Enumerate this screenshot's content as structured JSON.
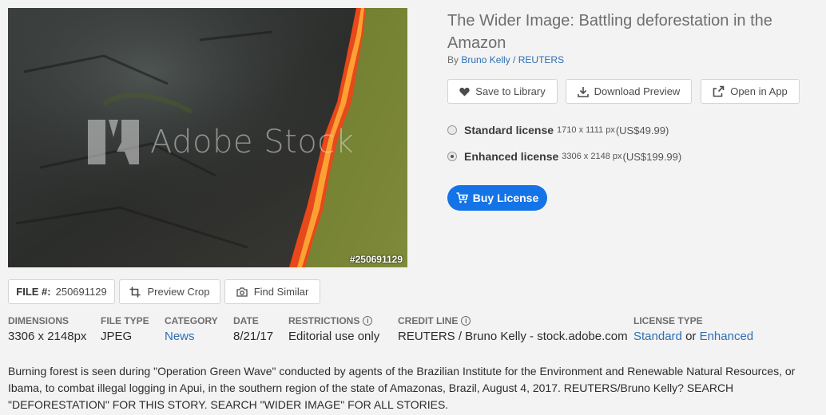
{
  "image": {
    "watermark": "Adobe Stock",
    "id_badge": "#250691129"
  },
  "title": "The Wider Image: Battling deforestation in the Amazon",
  "byline": {
    "prefix": "By",
    "author": "Bruno Kelly / REUTERS"
  },
  "actions": {
    "save": "Save to Library",
    "download": "Download Preview",
    "open": "Open in App"
  },
  "licenses": [
    {
      "name": "Standard license",
      "dims": "1710 x 1111 px",
      "price": "(US$49.99)",
      "selected": false
    },
    {
      "name": "Enhanced license",
      "dims": "3306 x 2148 px",
      "price": "(US$199.99)",
      "selected": true
    }
  ],
  "buy_label": "Buy License",
  "tools": {
    "file_label": "FILE #:",
    "file_number": "250691129",
    "preview_crop": "Preview Crop",
    "find_similar": "Find Similar"
  },
  "meta": {
    "dimensions": {
      "label": "DIMENSIONS",
      "value": "3306 x 2148px"
    },
    "file_type": {
      "label": "FILE TYPE",
      "value": "JPEG"
    },
    "category": {
      "label": "CATEGORY",
      "value": "News"
    },
    "date": {
      "label": "DATE",
      "value": "8/21/17"
    },
    "restrictions": {
      "label": "RESTRICTIONS",
      "value": "Editorial use only"
    },
    "credit_line": {
      "label": "CREDIT LINE",
      "value": "REUTERS / Bruno Kelly - stock.adobe.com"
    },
    "license_type": {
      "label": "LICENSE TYPE",
      "option1": "Standard",
      "joiner": "or",
      "option2": "Enhanced"
    }
  },
  "description": "Burning forest is seen during \"Operation Green Wave\" conducted by agents of the Brazilian Institute for the Environment and Renewable Natural Resources, or Ibama, to combat illegal logging in Apui, in the southern region of the state of Amazonas, Brazil, August 4, 2017. REUTERS/Bruno Kelly? SEARCH \"DEFORESTATION\" FOR THIS STORY. SEARCH \"WIDER IMAGE\" FOR ALL STORIES.",
  "colors": {
    "link": "#2d6fb5",
    "buy_button": "#1473e6",
    "fire": "#e8481a",
    "grass": "#6f7d2e"
  }
}
